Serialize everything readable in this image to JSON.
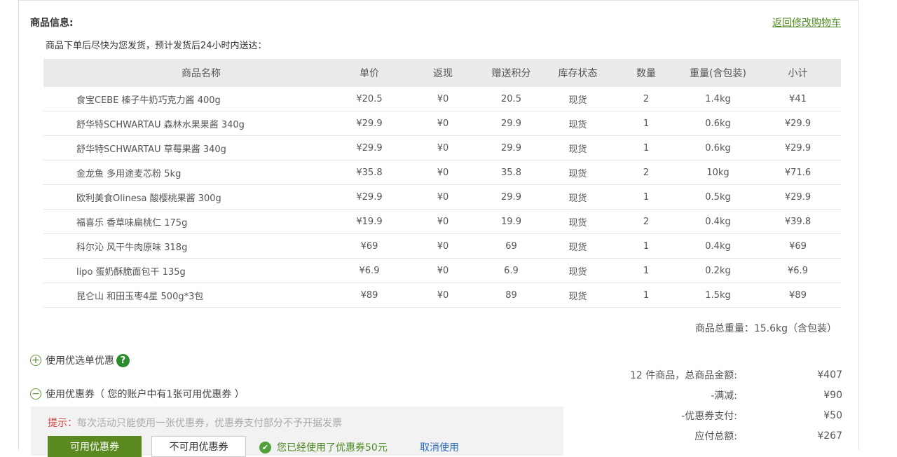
{
  "section_title": "商品信息:",
  "back_link": "返回修改购物车",
  "ship_note": "商品下单后尽快为您发货，预计发货后24小时内送达：",
  "table": {
    "headers": [
      "商品名称",
      "单价",
      "返现",
      "赠送积分",
      "库存状态",
      "数量",
      "重量(含包装)",
      "小计"
    ],
    "rows": [
      [
        "食宝CEBE 榛子牛奶巧克力酱 400g",
        "¥20.5",
        "¥0",
        "20.5",
        "现货",
        "2",
        "1.4kg",
        "¥41"
      ],
      [
        "舒华特SCHWARTAU 森林水果果酱 340g",
        "¥29.9",
        "¥0",
        "29.9",
        "现货",
        "1",
        "0.6kg",
        "¥29.9"
      ],
      [
        "舒华特SCHWARTAU 草莓果酱 340g",
        "¥29.9",
        "¥0",
        "29.9",
        "现货",
        "1",
        "0.6kg",
        "¥29.9"
      ],
      [
        "金龙鱼 多用途麦芯粉 5kg",
        "¥35.8",
        "¥0",
        "35.8",
        "现货",
        "2",
        "10kg",
        "¥71.6"
      ],
      [
        "欧利美食Olinesa 酸樱桃果酱 300g",
        "¥29.9",
        "¥0",
        "29.9",
        "现货",
        "1",
        "0.5kg",
        "¥29.9"
      ],
      [
        "福喜乐 香草味扁桃仁 175g",
        "¥19.9",
        "¥0",
        "19.9",
        "现货",
        "2",
        "0.4kg",
        "¥39.8"
      ],
      [
        "科尔沁 风干牛肉原味 318g",
        "¥69",
        "¥0",
        "69",
        "现货",
        "1",
        "0.4kg",
        "¥69"
      ],
      [
        "lipo 蛋奶酥脆面包干 135g",
        "¥6.9",
        "¥0",
        "6.9",
        "现货",
        "1",
        "0.2kg",
        "¥6.9"
      ],
      [
        "昆仑山 和田玉枣4星 500g*3包",
        "¥89",
        "¥0",
        "89",
        "现货",
        "1",
        "1.5kg",
        "¥89"
      ]
    ]
  },
  "total_weight": "商品总重量：15.6kg（含包装）",
  "options": {
    "selected_discount": "使用优选单优惠",
    "coupon": "使用优惠券（ 您的账户中有1张可用优惠券 ）"
  },
  "coupon_box": {
    "tip_label": "提示：",
    "tip_text": "每次活动只能使用一张优惠券，优惠券支付部分不予开据发票",
    "tab_available": "可用优惠券",
    "tab_unavailable": "不可用优惠券",
    "used_text": "您已经使用了优惠券50元",
    "cancel": "取消使用"
  },
  "summary": [
    {
      "label": "12 件商品，总商品金额:",
      "value": "¥407"
    },
    {
      "label": "-满减:",
      "value": "¥90"
    },
    {
      "label": "-优惠券支付:",
      "value": "¥50"
    },
    {
      "label": "应付总额:",
      "value": "¥267"
    }
  ],
  "colors": {
    "accent_green": "#5a8a20",
    "link_blue": "#2b6fbf",
    "tip_red": "#d94747"
  }
}
